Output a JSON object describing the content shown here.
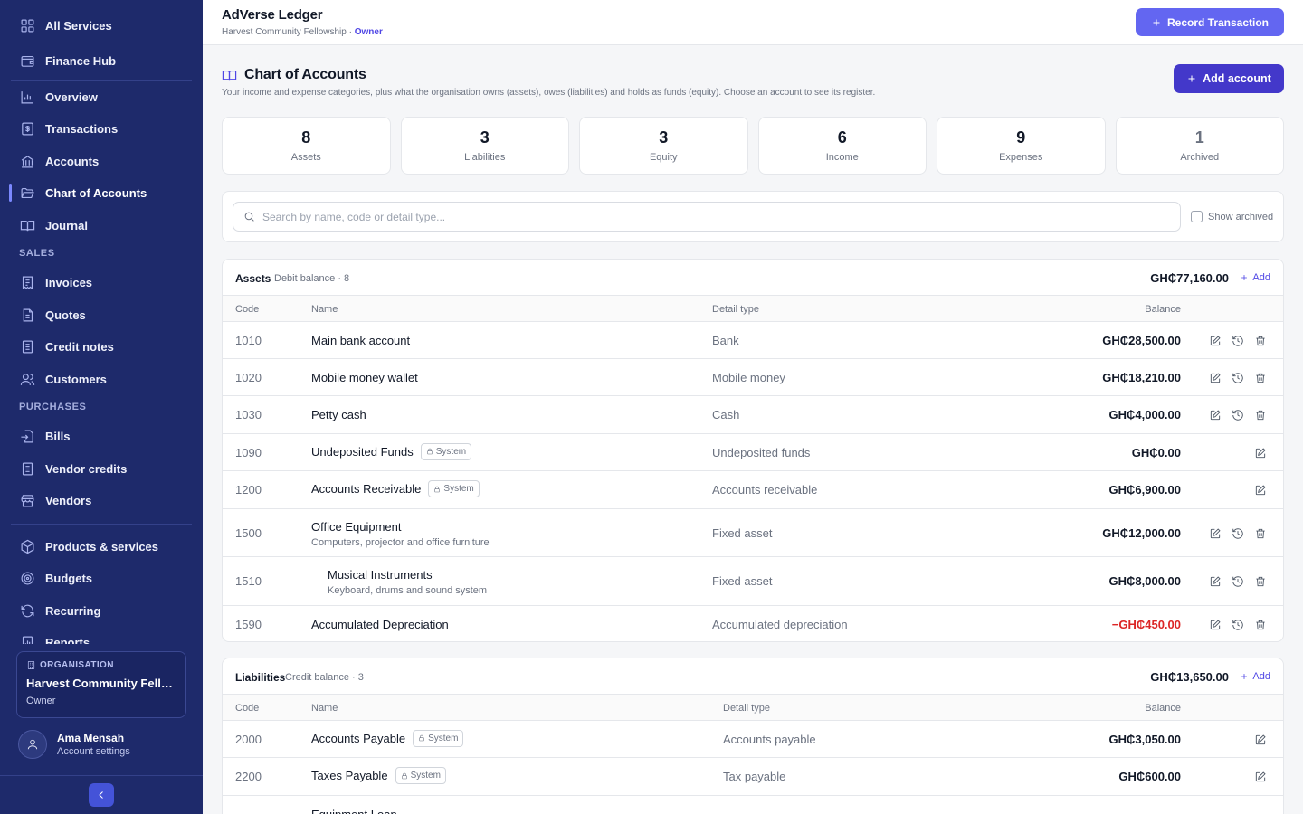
{
  "sidebar": {
    "items": [
      {
        "label": "All Services"
      },
      {
        "label": "Finance Hub"
      },
      {
        "label": "Overview"
      },
      {
        "label": "Transactions"
      },
      {
        "label": "Accounts"
      },
      {
        "label": "Chart of Accounts"
      },
      {
        "label": "Journal"
      },
      {
        "label": "Invoices"
      },
      {
        "label": "Quotes"
      },
      {
        "label": "Credit notes"
      },
      {
        "label": "Customers"
      },
      {
        "label": "Bills"
      },
      {
        "label": "Vendor credits"
      },
      {
        "label": "Vendors"
      },
      {
        "label": "Products & services"
      },
      {
        "label": "Budgets"
      },
      {
        "label": "Recurring"
      },
      {
        "label": "Reports"
      }
    ],
    "sections": {
      "sales": "SALES",
      "purchases": "PURCHASES"
    },
    "active_item": "Chart of Accounts",
    "org": {
      "label": "ORGANISATION",
      "name": "Harvest Community Fello...",
      "role": "Owner"
    },
    "user": {
      "name": "Ama Mensah",
      "sub": "Account settings"
    }
  },
  "header": {
    "title": "AdVerse Ledger",
    "org": "Harvest Community Fellowship",
    "separator": " · ",
    "role": "Owner",
    "record_button": "Record Transaction"
  },
  "page": {
    "title": "Chart of Accounts",
    "description": "Your income and expense categories, plus what the organisation owns (assets), owes (liabilities) and holds as funds (equity). Choose an account to see its register.",
    "add_button": "Add account"
  },
  "stats": [
    {
      "value": "8",
      "label": "Assets"
    },
    {
      "value": "3",
      "label": "Liabilities"
    },
    {
      "value": "3",
      "label": "Equity"
    },
    {
      "value": "6",
      "label": "Income"
    },
    {
      "value": "9",
      "label": "Expenses"
    },
    {
      "value": "1",
      "label": "Archived"
    }
  ],
  "search": {
    "placeholder": "Search by name, code or detail type...",
    "show_archived": "Show archived"
  },
  "columns": {
    "code": "Code",
    "name": "Name",
    "detail": "Detail type",
    "balance": "Balance"
  },
  "badge_system": "System",
  "add_label": "Add",
  "assets": {
    "title": "Assets",
    "sub": "Debit balance · 8",
    "total": "GH₵77,160.00",
    "rows": [
      {
        "code": "1010",
        "name": "Main bank account",
        "detail": "Bank",
        "balance": "GH₵28,500.00"
      },
      {
        "code": "1020",
        "name": "Mobile money wallet",
        "detail": "Mobile money",
        "balance": "GH₵18,210.00"
      },
      {
        "code": "1030",
        "name": "Petty cash",
        "detail": "Cash",
        "balance": "GH₵4,000.00"
      },
      {
        "code": "1090",
        "name": "Undeposited Funds",
        "detail": "Undeposited funds",
        "balance": "GH₵0.00"
      },
      {
        "code": "1200",
        "name": "Accounts Receivable",
        "detail": "Accounts receivable",
        "balance": "GH₵6,900.00"
      },
      {
        "code": "1500",
        "name": "Office Equipment",
        "desc": "Computers, projector and office furniture",
        "detail": "Fixed asset",
        "balance": "GH₵12,000.00"
      },
      {
        "code": "1510",
        "name": "Musical Instruments",
        "desc": "Keyboard, drums and sound system",
        "detail": "Fixed asset",
        "balance": "GH₵8,000.00"
      },
      {
        "code": "1590",
        "name": "Accumulated Depreciation",
        "detail": "Accumulated depreciation",
        "balance": "−GH₵450.00"
      }
    ]
  },
  "liabilities": {
    "title": "Liabilities",
    "sub": "Credit balance · 3",
    "total": "GH₵13,650.00",
    "rows": [
      {
        "code": "2000",
        "name": "Accounts Payable",
        "detail": "Accounts payable",
        "balance": "GH₵3,050.00"
      },
      {
        "code": "2200",
        "name": "Taxes Payable",
        "detail": "Tax payable",
        "balance": "GH₵600.00"
      },
      {
        "code": "",
        "name": "Equipment Loan",
        "detail": "",
        "balance": ""
      }
    ]
  }
}
